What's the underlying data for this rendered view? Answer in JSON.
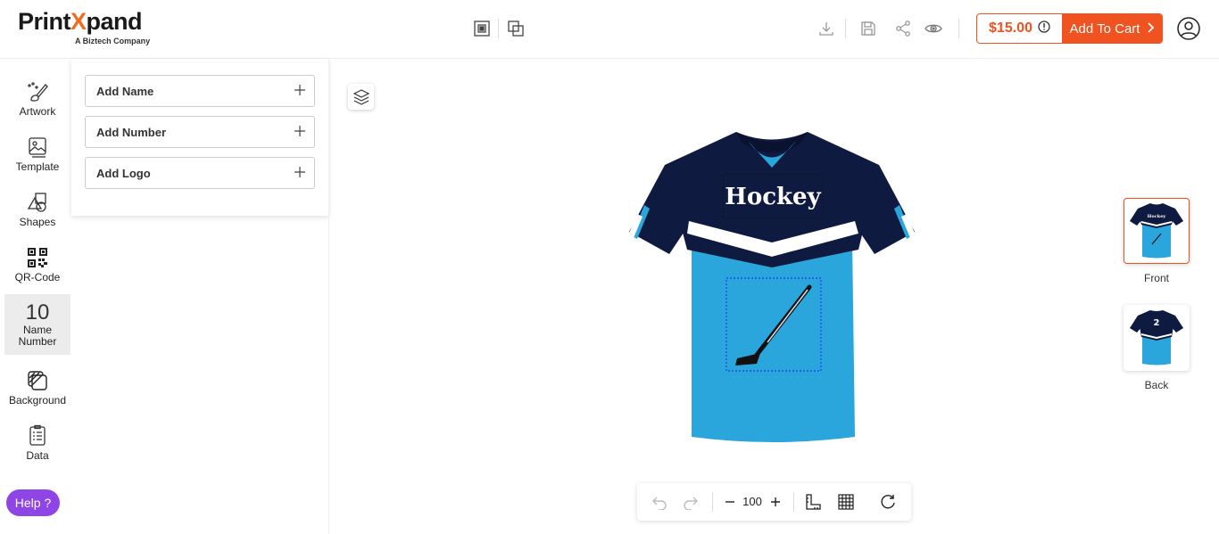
{
  "brand": {
    "name_part1": "Print",
    "name_x": "X",
    "name_part2": "pand",
    "tagline": "A Biztech Company"
  },
  "header": {
    "price": "$15.00",
    "add_to_cart": "Add To Cart",
    "icons": [
      "front-view-icon",
      "back-view-icon",
      "download-icon",
      "save-icon",
      "share-icon",
      "preview-icon",
      "info-icon",
      "chevron-right-icon",
      "user-icon"
    ]
  },
  "sidebar": {
    "items": [
      {
        "label": "Artwork"
      },
      {
        "label": "Template"
      },
      {
        "label": "Shapes"
      },
      {
        "label": "QR-Code"
      },
      {
        "label": "Name Number",
        "glyph": "10"
      },
      {
        "label": "Background"
      },
      {
        "label": "Data"
      }
    ],
    "help": "Help ?"
  },
  "panel": {
    "items": [
      {
        "label": "Add Name"
      },
      {
        "label": "Add Number"
      },
      {
        "label": "Add Logo"
      }
    ]
  },
  "canvas": {
    "front_text": "Hockey"
  },
  "views": [
    {
      "label": "Front",
      "number": ""
    },
    {
      "label": "Back",
      "number": "2"
    }
  ],
  "toolbar": {
    "zoom": "100"
  },
  "colors": {
    "accent": "#f0531f",
    "help": "#8f44e6",
    "jersey_navy": "#0f1a40",
    "jersey_blue": "#2aa6dc"
  }
}
